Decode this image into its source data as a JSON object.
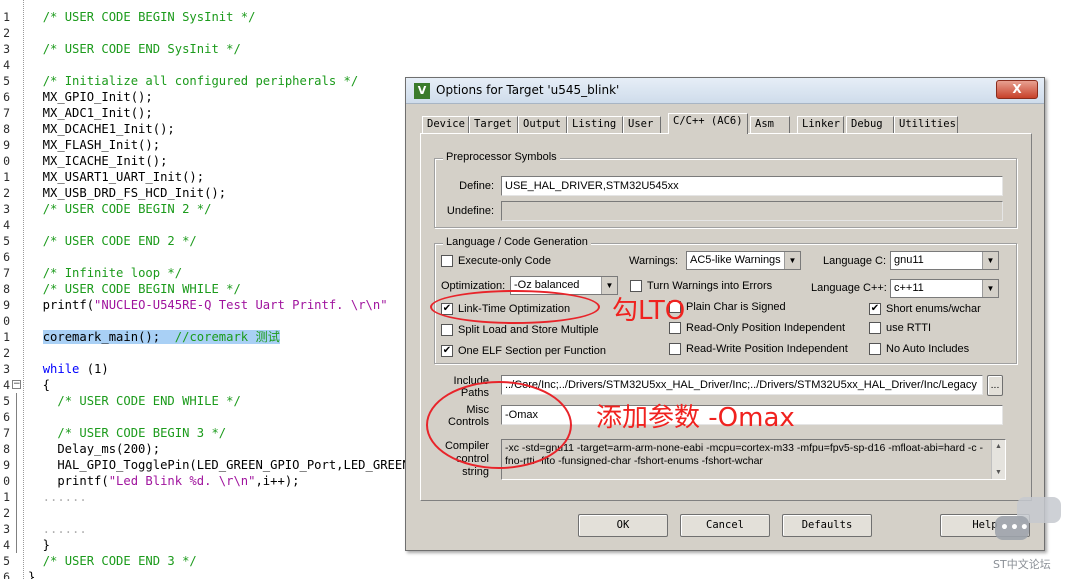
{
  "editor": {
    "lines": [
      {
        "num": "1",
        "segments": [
          {
            "cls": "ws",
            "t": "  "
          },
          {
            "cls": "c",
            "t": "/* USER CODE BEGIN SysInit */"
          }
        ]
      },
      {
        "num": "2",
        "segments": []
      },
      {
        "num": "3",
        "segments": [
          {
            "cls": "ws",
            "t": "  "
          },
          {
            "cls": "c",
            "t": "/* USER CODE END SysInit */"
          }
        ]
      },
      {
        "num": "4",
        "segments": []
      },
      {
        "num": "5",
        "segments": [
          {
            "cls": "ws",
            "t": "  "
          },
          {
            "cls": "c",
            "t": "/* Initialize all configured peripherals */"
          }
        ]
      },
      {
        "num": "6",
        "segments": [
          {
            "cls": "p",
            "t": "  MX_GPIO_Init();"
          }
        ]
      },
      {
        "num": "7",
        "segments": [
          {
            "cls": "p",
            "t": "  MX_ADC1_Init();"
          }
        ]
      },
      {
        "num": "8",
        "segments": [
          {
            "cls": "p",
            "t": "  MX_DCACHE1_Init();"
          }
        ]
      },
      {
        "num": "9",
        "segments": [
          {
            "cls": "p",
            "t": "  MX_FLASH_Init();"
          }
        ]
      },
      {
        "num": "0",
        "segments": [
          {
            "cls": "p",
            "t": "  MX_ICACHE_Init();"
          }
        ]
      },
      {
        "num": "1",
        "segments": [
          {
            "cls": "p",
            "t": "  MX_USART1_UART_Init();"
          }
        ]
      },
      {
        "num": "2",
        "segments": [
          {
            "cls": "p",
            "t": "  MX_USB_DRD_FS_HCD_Init();"
          }
        ]
      },
      {
        "num": "3",
        "segments": [
          {
            "cls": "ws",
            "t": "  "
          },
          {
            "cls": "c",
            "t": "/* USER CODE BEGIN 2 */"
          }
        ]
      },
      {
        "num": "4",
        "segments": []
      },
      {
        "num": "5",
        "segments": [
          {
            "cls": "ws",
            "t": "  "
          },
          {
            "cls": "c",
            "t": "/* USER CODE END 2 */"
          }
        ]
      },
      {
        "num": "6",
        "segments": []
      },
      {
        "num": "7",
        "segments": [
          {
            "cls": "ws",
            "t": "  "
          },
          {
            "cls": "c",
            "t": "/* Infinite loop */"
          }
        ]
      },
      {
        "num": "8",
        "segments": [
          {
            "cls": "ws",
            "t": "  "
          },
          {
            "cls": "c",
            "t": "/* USER CODE BEGIN WHILE */"
          }
        ]
      },
      {
        "num": "9",
        "segments": [
          {
            "cls": "p",
            "t": "  printf("
          },
          {
            "cls": "s",
            "t": "\"NUCLEO-U545RE-Q Test Uart Printf. \\r\\n\""
          }
        ]
      },
      {
        "num": "0",
        "segments": []
      },
      {
        "num": "1",
        "segments": [
          {
            "cls": "ws",
            "t": "  "
          },
          {
            "cls": "p hl",
            "t": "coremark_main();  "
          },
          {
            "cls": "c hl",
            "t": "//coremark 测试"
          }
        ]
      },
      {
        "num": "2",
        "segments": []
      },
      {
        "num": "3",
        "segments": [
          {
            "cls": "ws",
            "t": "  "
          },
          {
            "cls": "k",
            "t": "while"
          },
          {
            "cls": "p",
            "t": " (1)"
          }
        ]
      },
      {
        "num": "4",
        "segments": [
          {
            "cls": "p",
            "t": "  {"
          }
        ]
      },
      {
        "num": "5",
        "segments": [
          {
            "cls": "ws",
            "t": "    "
          },
          {
            "cls": "c",
            "t": "/* USER CODE END WHILE */"
          }
        ]
      },
      {
        "num": "6",
        "segments": []
      },
      {
        "num": "7",
        "segments": [
          {
            "cls": "ws",
            "t": "    "
          },
          {
            "cls": "c",
            "t": "/* USER CODE BEGIN 3 */"
          }
        ]
      },
      {
        "num": "8",
        "segments": [
          {
            "cls": "p",
            "t": "    Delay_ms(200);"
          }
        ]
      },
      {
        "num": "9",
        "segments": [
          {
            "cls": "p",
            "t": "    HAL_GPIO_TogglePin(LED_GREEN_GPIO_Port,LED_GREEN_Pin);"
          }
        ]
      },
      {
        "num": "0",
        "segments": [
          {
            "cls": "p",
            "t": "    printf("
          },
          {
            "cls": "s",
            "t": "\"Led Blink %d. \\r\\n\""
          },
          {
            "cls": "p",
            "t": ",i++);"
          }
        ]
      },
      {
        "num": "1",
        "segments": [
          {
            "cls": "ws",
            "t": "  ......"
          }
        ]
      },
      {
        "num": "2",
        "segments": []
      },
      {
        "num": "3",
        "segments": [
          {
            "cls": "ws",
            "t": "  ......"
          }
        ]
      },
      {
        "num": "4",
        "segments": [
          {
            "cls": "p",
            "t": "  }"
          }
        ]
      },
      {
        "num": "5",
        "segments": [
          {
            "cls": "ws",
            "t": "  "
          },
          {
            "cls": "c",
            "t": "/* USER CODE END 3 */"
          }
        ]
      },
      {
        "num": "6",
        "segments": [
          {
            "cls": "p",
            "t": "}"
          }
        ]
      }
    ]
  },
  "dialog": {
    "title": "Options for Target 'u545_blink'",
    "icon_label": "V",
    "close_label": "X",
    "tabs": [
      {
        "label": "Device"
      },
      {
        "label": "Target"
      },
      {
        "label": "Output"
      },
      {
        "label": "Listing"
      },
      {
        "label": "User"
      },
      {
        "label": "C/C++ (AC6)"
      },
      {
        "label": "Asm"
      },
      {
        "label": "Linker"
      },
      {
        "label": "Debug"
      },
      {
        "label": "Utilities"
      }
    ],
    "preprocessor": {
      "title": "Preprocessor Symbols",
      "define_label": "Define:",
      "define_value": "USE_HAL_DRIVER,STM32U545xx",
      "undefine_label": "Undefine:",
      "undefine_value": ""
    },
    "codegen": {
      "title": "Language / Code Generation",
      "execute_only": "Execute-only Code",
      "warnings_label": "Warnings:",
      "warnings_value": "AC5-like Warnings",
      "lang_c_label": "Language C:",
      "lang_c_value": "gnu11",
      "optimization_label": "Optimization:",
      "optimization_value": "-Oz balanced",
      "turn_warnings": "Turn Warnings into Errors",
      "lang_cpp_label": "Language C++:",
      "lang_cpp_value": "c++11",
      "lto": "Link-Time Optimization",
      "plain_char": "Plain Char is Signed",
      "short_enums": "Short enums/wchar",
      "split_load": "Split Load and Store Multiple",
      "ro_pos": "Read-Only Position Independent",
      "use_rtti": "use RTTI",
      "one_elf": "One ELF Section per Function",
      "rw_pos": "Read-Write Position Independent",
      "no_auto": "No Auto Includes"
    },
    "include": {
      "label_line1": "Include",
      "label_line2": "Paths",
      "value": "../Core/Inc;../Drivers/STM32U5xx_HAL_Driver/Inc;../Drivers/STM32U5xx_HAL_Driver/Inc/Legacy",
      "browse_label": "..."
    },
    "misc": {
      "label_line1": "Misc",
      "label_line2": "Controls",
      "value": "-Omax"
    },
    "compiler": {
      "label_line1": "Compiler",
      "label_line2": "control",
      "label_line3": "string",
      "value": "-xc -std=gnu11 -target=arm-arm-none-eabi -mcpu=cortex-m33 -mfpu=fpv5-sp-d16 -mfloat-abi=hard -c -fno-rtti -flto -funsigned-char -fshort-enums -fshort-wchar"
    },
    "buttons": {
      "ok": "OK",
      "cancel": "Cancel",
      "defaults": "Defaults",
      "help": "Help"
    }
  },
  "annotations": {
    "lto_note": "勾LTO",
    "misc_note": "添加参数 -Omax"
  },
  "watermark": {
    "text": "ST中文论坛",
    "dots": "•••"
  },
  "colors": {
    "annotation": "#e8242a",
    "comment": "#1c9b1c",
    "keyword": "#0000ff",
    "string": "#a0149e",
    "highlight": "#a9d0f5"
  }
}
